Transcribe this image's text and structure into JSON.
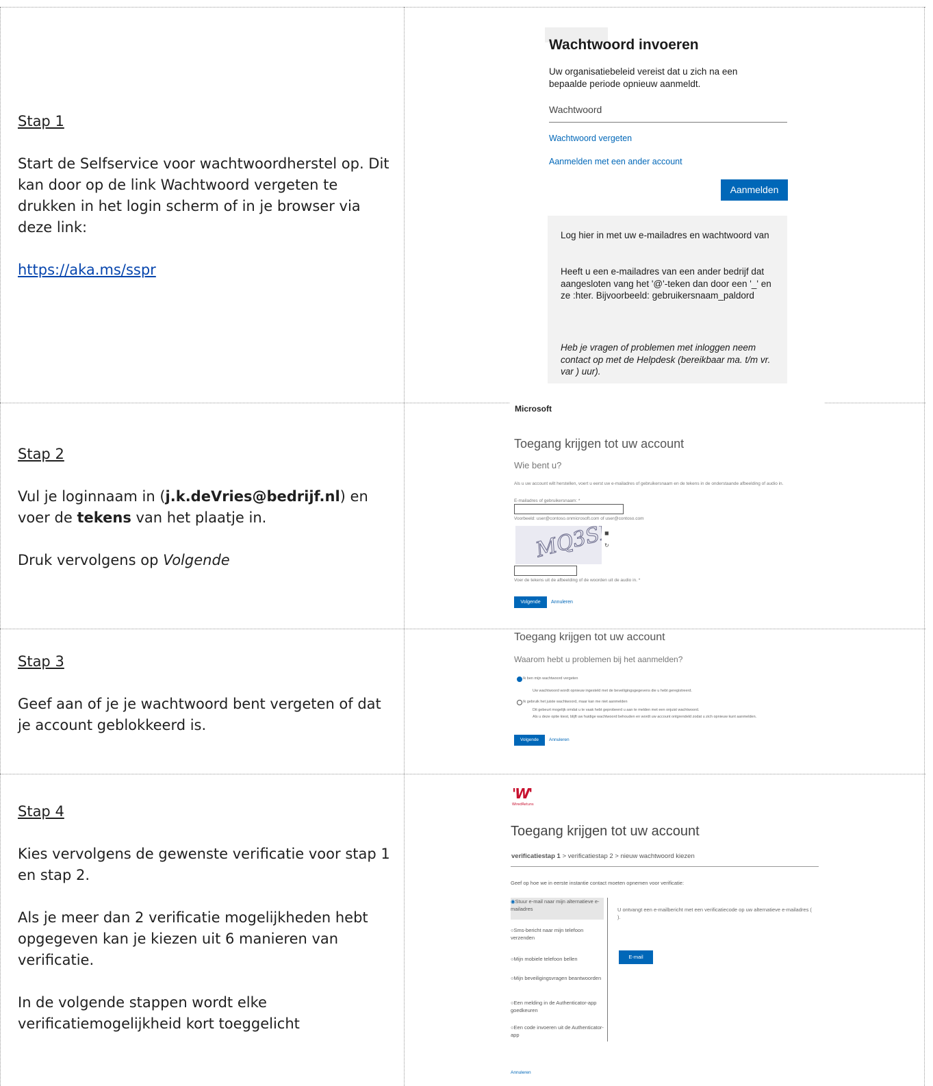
{
  "steps": [
    {
      "title": "Stap 1",
      "paragraphs": [
        "Start de Selfservice voor wachtwoordherstel op. Dit kan door op de link Wachtwoord vergeten te drukken in het login scherm of in je browser via deze link:"
      ],
      "link": "https://aka.ms/sspr"
    },
    {
      "title": "Stap 2",
      "p1_a": "Vul je loginnaam in (",
      "p1_b": "j.k.deVries@bedrijf.nl",
      "p1_c": ") en voer de ",
      "p1_d": "tekens",
      "p1_e": " van het plaatje in.",
      "p2_a": "Druk vervolgens op ",
      "p2_b": "Volgende"
    },
    {
      "title": "Stap 3",
      "paragraphs": [
        "Geef aan of je je wachtwoord bent vergeten of dat je account geblokkeerd is."
      ]
    },
    {
      "title": "Stap 4",
      "paragraphs": [
        "Kies vervolgens de gewenste verificatie voor stap 1 en stap 2.",
        "Als je meer dan 2 verificatie mogelijkheden hebt opgegeven kan je kiezen uit 6 manieren van verificatie.",
        "In de volgende stappen wordt elke verificatiemogelijkheid kort toeggelicht"
      ]
    }
  ],
  "shot1": {
    "heading": "Wachtwoord invoeren",
    "desc": "Uw organisatiebeleid vereist dat u zich na een bepaalde periode opnieuw aanmeldt.",
    "password_placeholder": "Wachtwoord",
    "forgot_link": "Wachtwoord vergeten",
    "other_account_link": "Aanmelden met een ander account",
    "signin_button": "Aanmelden",
    "info_1": "Log hier in met uw e-mailadres en wachtwoord van",
    "info_2": "Heeft u een e-mailadres van een ander bedrijf dat aangesloten                    vang het '@'-teken dan door een '_' en ze                          :hter. Bijvoorbeeld: gebruikersnaam_paldord",
    "info_3": "Heb je vragen of problemen met inloggen neem contact op met de Helpdesk (bereikbaar ma. t/m vr. var                        ) uur)."
  },
  "shot2": {
    "brand": "Microsoft",
    "title": "Toegang krijgen tot uw account",
    "subtitle": "Wie bent u?",
    "instructions": "Als u uw account wilt herstellen, voert u eerst uw e-mailadres of gebruikersnaam en de tekens in de onderstaande afbeelding of audio in.",
    "email_label": "E-mailadres of gebruikersnaam: *",
    "example": "Voorbeeld: user@contoso.onmicrosoft.com of user@contoso.com",
    "captcha_text": "MQ3SR",
    "captcha_label": "Voer de tekens uit de afbeelding of de woorden uit de audio in. *",
    "next_button": "Volgende",
    "cancel_link": "Annuleren"
  },
  "shot3": {
    "title": "Toegang krijgen tot uw account",
    "subtitle": "Waarom hebt u problemen bij het aanmelden?",
    "opt1": "Ik ben mijn wachtwoord vergeten",
    "opt1_desc": "Uw wachtwoord wordt opnieuw ingesteld met de beveiligingsgegevens die u hebt geregistreerd.",
    "opt2": "Ik gebruik het juiste wachtwoord, maar kan me niet aanmelden",
    "opt2_desc1": "Dit gebeurt mogelijk omdat u te vaak hebt geprobeerd u aan te melden met een onjuist wachtwoord.",
    "opt2_desc2": "Als u deze optie kiest, blijft uw huidige wachtwoord behouden en wordt uw account ontgrendeld zodat u zich opnieuw kunt aanmelden.",
    "next_button": "Volgende",
    "cancel_link": "Annuleren"
  },
  "shot4": {
    "logo_caption": "WiredRetuns",
    "title": "Toegang krijgen tot uw account",
    "bc_1": "verificatiestap 1",
    "bc_2": " > verificatiestap 2 > nieuw wachtwoord kiezen",
    "question": "Geef op hoe we in eerste instantie contact moeten opnemen voor verificatie:",
    "options": [
      "Stuur e-mail naar mijn alternatieve e-mailadres",
      "Sms-bericht naar mijn telefoon verzenden",
      "Mijn mobiele telefoon bellen",
      "Mijn beveiligingsvragen beantwoorden",
      "Een melding in de Authenticator-app goedkeuren",
      "Een code invoeren uit de Authenticator-app"
    ],
    "info": "U ontvangt een e-mailbericht met een verificatiecode op uw alternatieve e-mailadres (                                  ).",
    "email_button": "E-mail",
    "cancel_link": "Annuleren"
  }
}
